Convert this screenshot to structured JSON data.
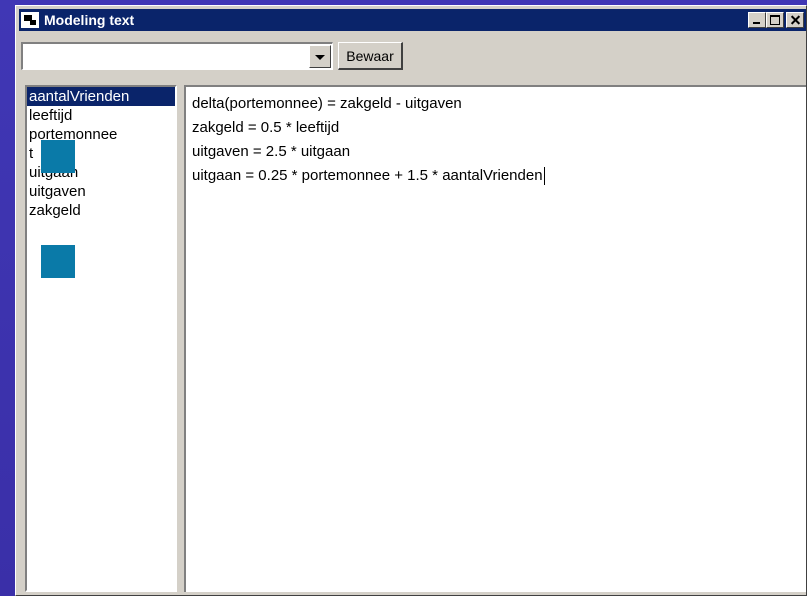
{
  "window": {
    "title": "Modeling text"
  },
  "toolbar": {
    "combo_value": "",
    "save_label": "Bewaar"
  },
  "list": {
    "items": [
      "aantalVrienden",
      "leeftijd",
      "portemonnee",
      "t",
      "uitgaan",
      "uitgaven",
      "zakgeld"
    ],
    "selected_index": 0
  },
  "editor": {
    "lines": [
      "delta(portemonnee) = zakgeld - uitgaven",
      "zakgeld = 0.5 * leeftijd",
      "uitgaven = 2.5 * uitgaan",
      "uitgaan = 0.25 * portemonnee + 1.5 * aantalVrienden"
    ]
  },
  "icons": {
    "app": "app-icon",
    "minimize": "minimize-icon",
    "maximize": "maximize-icon",
    "close": "close-icon",
    "dropdown": "chevron-down-icon"
  },
  "colors": {
    "titlebar": "#0a246a",
    "selection": "#0a246a",
    "background": "#3a2fa8",
    "artifact_square": "#0a7aa8"
  }
}
